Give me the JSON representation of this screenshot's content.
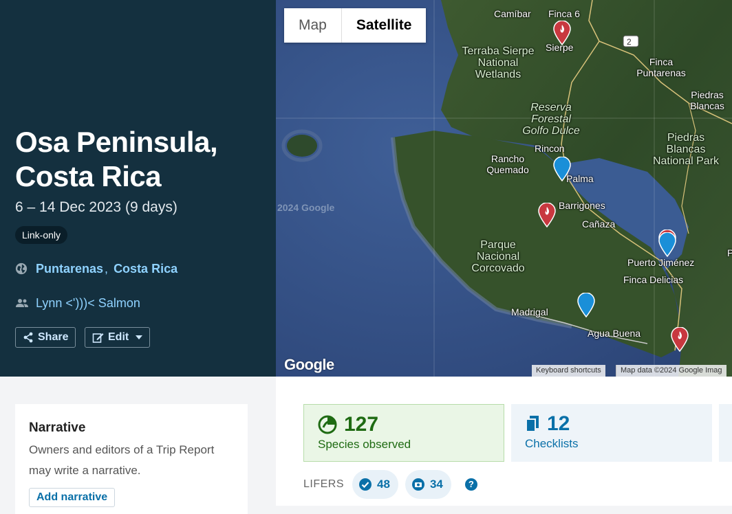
{
  "trip": {
    "title": "Osa Peninsula, Costa Rica",
    "dates": "6 – 14 Dec 2023 (9 days)",
    "visibility": "Link-only",
    "location_region": "Puntarenas",
    "location_separator": ",",
    "location_country": "Costa Rica",
    "owner": "Lynn <')))< Salmon"
  },
  "actions": {
    "share_label": "Share",
    "edit_label": "Edit"
  },
  "map": {
    "type_map": "Map",
    "type_satellite": "Satellite",
    "labels": {
      "camibar": "Camíbar",
      "finca6": "Finca 6",
      "sierpe": "Sierpe",
      "route2": "2",
      "terraba": "Terraba Sierpe National Wetlands",
      "finca_puntarenas": "Finca Puntarenas",
      "piedras_blancas": "Piedras Blancas",
      "reserva": "Reserva Forestal Golfo Dulce",
      "rincon": "Rincon",
      "rancho": "Rancho Quemado",
      "palma": "Palma",
      "pbnp": "Piedras Blancas National Park",
      "copyright_watermark": "2024 Google",
      "barrigones": "Barrigones",
      "canaza": "Cañaza",
      "corcovado": "Parque Nacional Corcovado",
      "puerto_jimenez": "Puerto Jiménez",
      "finca_delicias": "Finca Delicias",
      "madrigal": "Madrigal",
      "agua_buena": "Agua Buena",
      "edge_p": "P"
    },
    "google_logo": "Google",
    "keyboard_shortcuts": "Keyboard shortcuts",
    "map_data": "Map data ©2024 Google Imag",
    "pin_colors": {
      "red": "#c8383f",
      "blue": "#1a8fd8"
    }
  },
  "narrative": {
    "title": "Narrative",
    "text": "Owners and editors of a Trip Report may write a narrative.",
    "button": "Add narrative"
  },
  "stats": {
    "species_count": "127",
    "species_label": "Species observed",
    "checklists_count": "12",
    "checklists_label": "Checklists"
  },
  "lifers": {
    "label": "LIFERS",
    "seen_count": "48",
    "photo_count": "34",
    "help": "?"
  }
}
